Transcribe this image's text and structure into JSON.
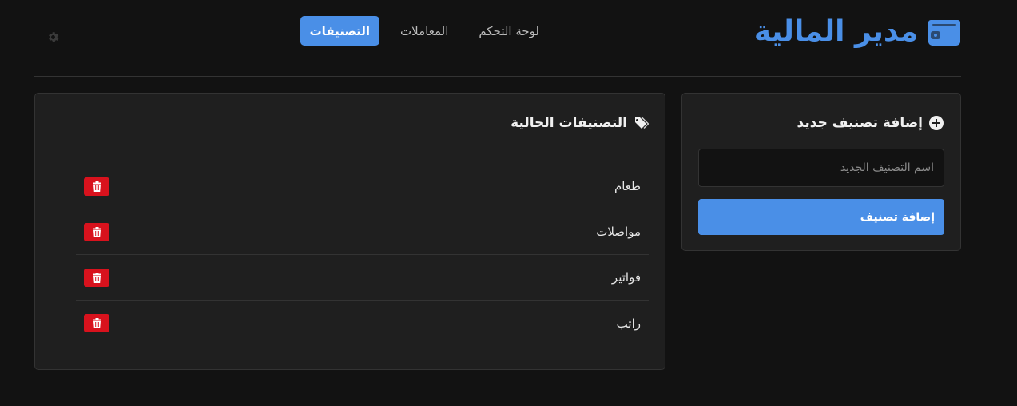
{
  "app": {
    "title": "مدير المالية",
    "brand_color": "#4a8fe7",
    "brand_icon": "wallet-icon"
  },
  "nav": {
    "tabs": [
      {
        "label": "لوحة التحكم",
        "active": false
      },
      {
        "label": "المعاملات",
        "active": false
      },
      {
        "label": "التصنيفات",
        "active": true
      }
    ]
  },
  "settings": {
    "icon": "gear-icon"
  },
  "add_panel": {
    "title": "إضافة تصنيف جديد",
    "icon": "plus-circle-icon",
    "input_placeholder": "اسم التصنيف الجديد",
    "input_value": "",
    "button_label": "إضافة تصنيف"
  },
  "list_panel": {
    "title": "التصنيفات الحالية",
    "icon": "tags-icon",
    "categories": [
      {
        "name": "طعام"
      },
      {
        "name": "مواصلات"
      },
      {
        "name": "فواتير"
      },
      {
        "name": "راتب"
      }
    ],
    "delete_icon": "trash-icon",
    "delete_color": "#d8121d"
  }
}
